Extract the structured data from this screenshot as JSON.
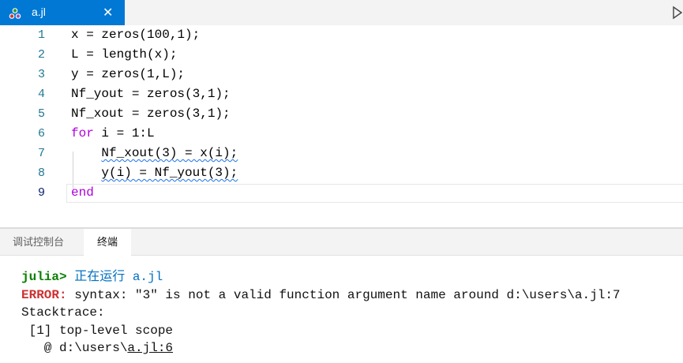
{
  "tab": {
    "filename": "a.jl",
    "close_glyph": "✕",
    "file_icon": "julia-dots-icon",
    "accent": "#0078d4"
  },
  "editor": {
    "line_numbers": [
      "1",
      "2",
      "3",
      "4",
      "5",
      "6",
      "7",
      "8",
      "9"
    ],
    "lines": [
      {
        "plain_a": "x = ",
        "fn": "zeros",
        "args": "(100,1);"
      },
      {
        "plain_a": "L = ",
        "fn": "length",
        "args": "(x);"
      },
      {
        "plain_a": "y = ",
        "fn": "zeros",
        "args": "(1,L);"
      },
      {
        "plain_a": "Nf_yout = ",
        "fn": "zeros",
        "args": "(3,1);"
      },
      {
        "plain_a": "Nf_xout = ",
        "fn": "zeros",
        "args": "(3,1);"
      },
      {
        "kw": "for",
        "rest": " i = 1:L"
      },
      {
        "indent": "    ",
        "text": "Nf_xout(3) = x(i);"
      },
      {
        "indent": "    ",
        "text": "y(i) = Nf_yout(3);"
      },
      {
        "kw": "end"
      }
    ]
  },
  "panel": {
    "tabs": [
      "调试控制台",
      "终端"
    ],
    "active_tab": "终端"
  },
  "terminal": {
    "prompt": "julia>",
    "command": " 正在运行 a.jl",
    "error_label": "ERROR:",
    "error_msg": " syntax: \"3\" is not a valid function argument name around d:\\users\\a.jl:7",
    "stacktrace_label": "Stacktrace:",
    "frame": " [1] top-level scope",
    "location_prefix": "   @ d:\\users\\",
    "location_link": "a.jl:6"
  }
}
